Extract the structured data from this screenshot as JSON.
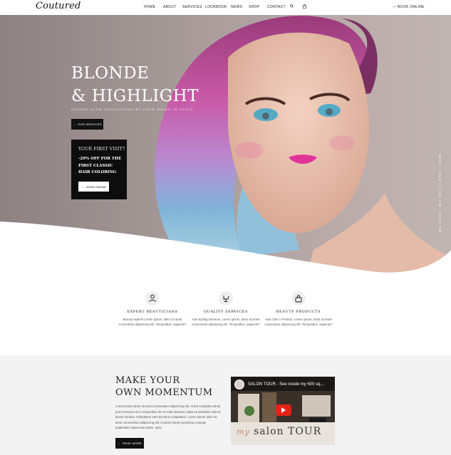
{
  "header": {
    "logo": "Coutured",
    "nav": [
      "HOME",
      "ABOUT",
      "SERVICES",
      "LOOKBOOK",
      "NEWS",
      "SHOP",
      "CONTACT"
    ],
    "book_online": "— BOOK ONLINE"
  },
  "hero": {
    "title_line1": "BLONDE",
    "title_line2": "& HIGHLIGHT",
    "subtitle": "DEVIDE YOUR UNIQUENESS BY YOUR HAIRS IN STYLE",
    "services_button": "OUR SERVICES",
    "promo": {
      "question": "YOUR FIRST VISIT?",
      "offer": "-20% OFF FOR THE FIRST CLASSIC HAIR COLORING",
      "button": "BOOK ONLINE"
    },
    "hours": "MON – SUN : 7:00 AM – 8:00 PM"
  },
  "features": [
    {
      "icon": "beautician-icon",
      "title": "EXPERT BEAUTICIANS",
      "text": "Beauty experts Lorem ipsum, dolor sit amet consectetur adipisicing elit. Tempotibus, sapiente?"
    },
    {
      "icon": "salon-chair-icon",
      "title": "QUALITY SERVICES",
      "text": "Hair Styling Services, Lorem ipsum, dolor sit amet consectetur adipisicing elit. Tempotibus, sapiente?"
    },
    {
      "icon": "product-icon",
      "title": "BEAUTY PRODUCTS",
      "text": "Hair color n Product, Lorem ipsum, dolor sit amet consectetur adipisicing elit. Tempotibus, sapiente?"
    }
  ],
  "momentum": {
    "title_line1": "MAKE YOUR",
    "title_line2": "OWN MOMENTUM",
    "body": "Lorem ipsum dolor sit amet consectetur adipisicing elit. Animi voluptates dicta porro tempora sint, temporibus hic et nulla ducimus culpa ea doloribus odio et ipsum minima. Voluptatem sunt ducimus voluptatum. Lorem ipsum dolor sit amet consectetur adipisicing elit. Incidunt harum possimus cumque quibusdam alias iusto totam. Quis.",
    "read_more": "READ MORE",
    "video_title": "SALON TOUR - See inside my 600 sq...",
    "video_overlay_script": "my",
    "video_overlay_text": "salon TOUR"
  },
  "colors": {
    "accent": "#111111",
    "hero_bg": "#a39796",
    "promo_bg": "#0d0d0d",
    "play": "#e62117"
  }
}
